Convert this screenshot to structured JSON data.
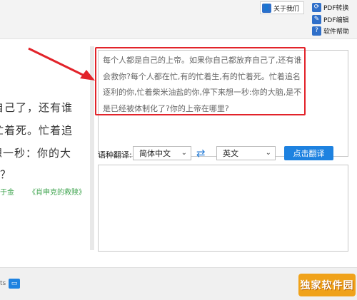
{
  "toolbar": {
    "about_label": "关于我们",
    "pdf_convert_label": "PDF转换",
    "pdf_edit_label": "PDF编辑",
    "help_label": "软件帮助"
  },
  "source_panel": {
    "text": "每个人都是自己的上帝。如果你自己都放弃自己了,还有谁会救你?每个人都在忙,有的忙着生,有的忙着死。忙着追名逐利的你,忙着柴米油盐的你,停下来想一秒:你的大脑,是不是已经被体制化了?你的上帝在哪里?"
  },
  "preview_panel": {
    "lines": [
      "自己了，还有谁",
      "忙着死。忙着追",
      "想一秒：你的大",
      "？"
    ],
    "byline_a": "于金",
    "byline_b": "《肖申克的救赎》"
  },
  "translate": {
    "label": "语种翻译:",
    "from_value": "简体中文",
    "to_value": "英文",
    "swap_icon": "swap-arrows-icon",
    "button_label": "点击翻译"
  },
  "bottom": {
    "partial_text": "ts",
    "watermark_text": "独家软件园"
  },
  "colors": {
    "accent": "#1e82e0",
    "highlight": "#e2232a",
    "quote_green": "#3aa24a"
  }
}
